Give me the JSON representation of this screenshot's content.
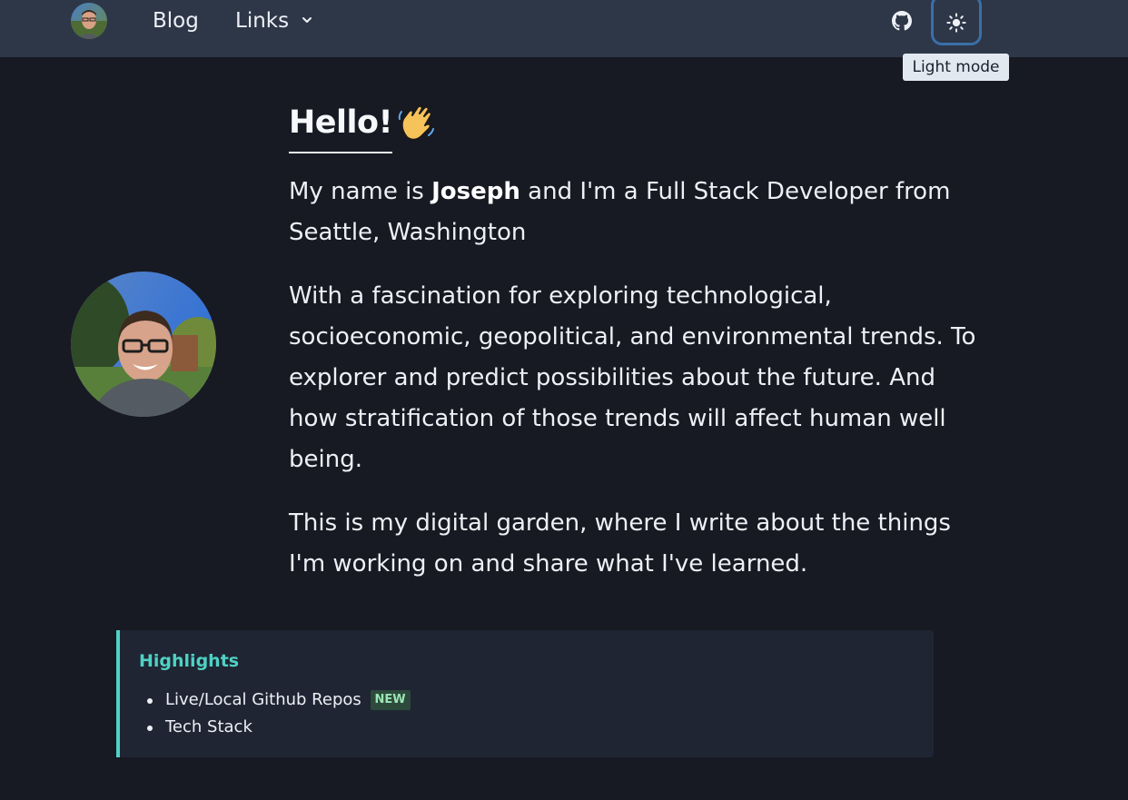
{
  "nav": {
    "avatar_alt": "Joseph avatar",
    "blog_label": "Blog",
    "links_label": "Links",
    "github_icon": "github-icon",
    "theme_icon": "sun-icon",
    "theme_tooltip": "Light mode"
  },
  "intro": {
    "heading": "Hello!",
    "heading_emoji": "waving-hand",
    "p1_prefix": "My name is ",
    "p1_name": "Joseph",
    "p1_suffix": " and I'm a Full Stack Developer from Seattle, Washington",
    "p2": "With a fascination for exploring technological, socioeconomic, geopolitical, and environmental trends. To explorer and predict possibilities about the future. And how stratification of those trends will affect human well being.",
    "p3": "This is my digital garden, where I write about the things I'm working on and share what I've learned."
  },
  "highlights": {
    "title": "Highlights",
    "items": [
      {
        "label": "Live/Local Github Repos",
        "badge": "NEW"
      },
      {
        "label": "Tech Stack"
      }
    ]
  },
  "colors": {
    "background": "#171923",
    "header": "#2d3748",
    "accent": "#4fd1c5",
    "badge_text": "#9ae6b4"
  }
}
